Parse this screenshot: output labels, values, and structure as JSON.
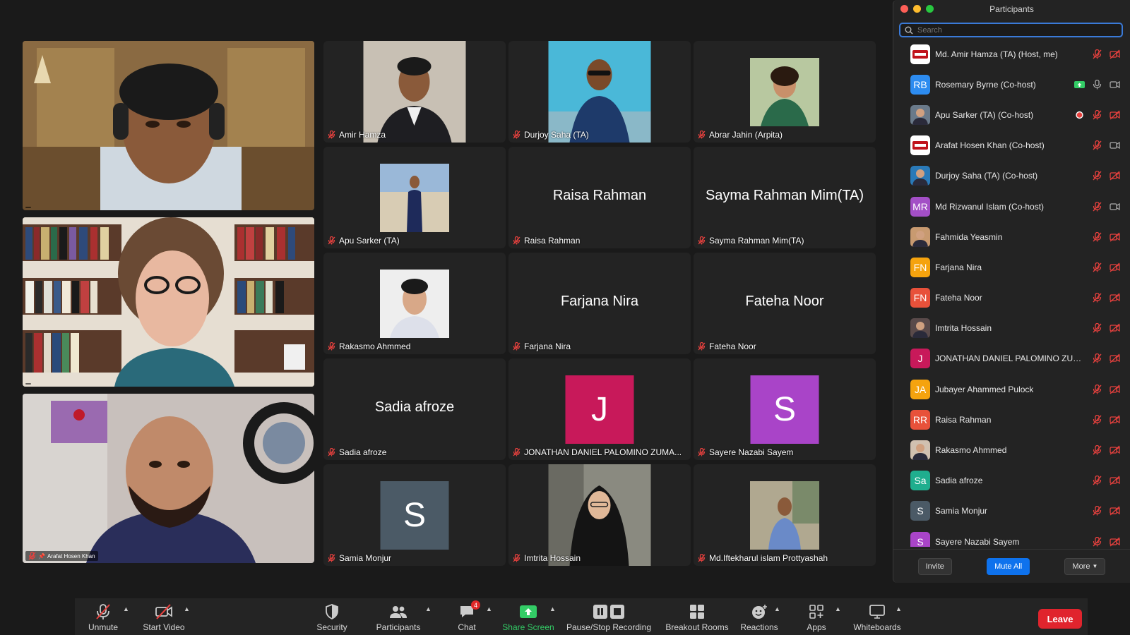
{
  "colors": {
    "accent": "#0e72ed",
    "mute_red": "#e8413e",
    "share_green": "#33cc66",
    "leave_red": "#e0242d"
  },
  "speakers": [
    {
      "name": ""
    },
    {
      "name": ""
    },
    {
      "name": "Arafat Hosen Khan"
    }
  ],
  "gallery": [
    {
      "label": "Amir Hamza",
      "kind": "photo"
    },
    {
      "label": "Durjoy Saha (TA)",
      "kind": "photo"
    },
    {
      "label": "Abrar Jahin (Arpita)",
      "kind": "photo-small"
    },
    {
      "label": "Apu Sarker (TA)",
      "kind": "photo-small"
    },
    {
      "label": "Raisa Rahman",
      "kind": "name",
      "big": "Raisa Rahman"
    },
    {
      "label": "Sayma Rahman Mim(TA)",
      "kind": "name",
      "big": "Sayma Rahman Mim(TA)"
    },
    {
      "label": "Rakasmo Ahmmed",
      "kind": "photo-small"
    },
    {
      "label": "Farjana Nira",
      "kind": "name",
      "big": "Farjana Nira"
    },
    {
      "label": "Fateha Noor",
      "kind": "name",
      "big": "Fateha Noor"
    },
    {
      "label": "Sadia afroze",
      "kind": "name",
      "big": "Sadia afroze"
    },
    {
      "label": "JONATHAN DANIEL PALOMINO ZUMA...",
      "kind": "avatar",
      "letter": "J",
      "color": "#c8195a"
    },
    {
      "label": "Sayere Nazabi Sayem",
      "kind": "avatar",
      "letter": "S",
      "color": "#a944c8"
    },
    {
      "label": "Samia Monjur",
      "kind": "avatar",
      "letter": "S",
      "color": "#4b5a66"
    },
    {
      "label": "Imtrita Hossain",
      "kind": "photo"
    },
    {
      "label": "Md.Iftekharul islam Prottyashah",
      "kind": "photo-small"
    }
  ],
  "participants_panel": {
    "title": "Participants",
    "search_placeholder": "Search",
    "items": [
      {
        "name": "Md. Amir Hamza (TA) (Host, me)",
        "avatar": "logo",
        "color": "#ffffff",
        "mic": "muted",
        "video": "off"
      },
      {
        "name": "Rosemary Byrne (Co-host)",
        "avatar": "RB",
        "color": "#2d8cf0",
        "mic": "on",
        "video": "on",
        "sharing": true
      },
      {
        "name": "Apu Sarker (TA) (Co-host)",
        "avatar": "photo",
        "color": "#6a7a8a",
        "mic": "muted",
        "video": "off",
        "recording": true
      },
      {
        "name": "Arafat Hosen Khan (Co-host)",
        "avatar": "logo",
        "color": "#ffffff",
        "mic": "muted",
        "video": "on"
      },
      {
        "name": "Durjoy Saha (TA) (Co-host)",
        "avatar": "photo",
        "color": "#2a7ab8",
        "mic": "muted",
        "video": "off"
      },
      {
        "name": "Md Rizwanul Islam (Co-host)",
        "avatar": "MR",
        "color": "#a34fc6",
        "mic": "muted",
        "video": "on"
      },
      {
        "name": "Fahmida Yeasmin",
        "avatar": "photo",
        "color": "#c89a70",
        "mic": "muted",
        "video": "off"
      },
      {
        "name": "Farjana Nira",
        "avatar": "FN",
        "color": "#f5a30e",
        "mic": "muted",
        "video": "off"
      },
      {
        "name": "Fateha Noor",
        "avatar": "FN",
        "color": "#e8513a",
        "mic": "muted",
        "video": "off"
      },
      {
        "name": "Imtrita Hossain",
        "avatar": "photo",
        "color": "#5a4a4a",
        "mic": "muted",
        "video": "off"
      },
      {
        "name": "JONATHAN DANIEL PALOMINO ZUM...",
        "avatar": "J",
        "color": "#c8195a",
        "mic": "muted",
        "video": "off"
      },
      {
        "name": "Jubayer Ahammed Pulock",
        "avatar": "JA",
        "color": "#f5a30e",
        "mic": "muted",
        "video": "off"
      },
      {
        "name": "Raisa Rahman",
        "avatar": "RR",
        "color": "#e8513a",
        "mic": "muted",
        "video": "off"
      },
      {
        "name": "Rakasmo Ahmmed",
        "avatar": "photo",
        "color": "#d0c0b0",
        "mic": "muted",
        "video": "off"
      },
      {
        "name": "Sadia afroze",
        "avatar": "Sa",
        "color": "#1fae8e",
        "mic": "muted",
        "video": "off"
      },
      {
        "name": "Samia Monjur",
        "avatar": "S",
        "color": "#4b5a66",
        "mic": "muted",
        "video": "off"
      },
      {
        "name": "Sayere Nazabi Sayem",
        "avatar": "S",
        "color": "#a944c8",
        "mic": "muted",
        "video": "off"
      }
    ],
    "invite_label": "Invite",
    "mute_all_label": "Mute All",
    "more_label": "More"
  },
  "toolbar": {
    "unmute": "Unmute",
    "start_video": "Start Video",
    "security": "Security",
    "participants": "Participants",
    "chat": "Chat",
    "chat_badge": "4",
    "share_screen": "Share Screen",
    "recording": "Pause/Stop Recording",
    "breakout": "Breakout Rooms",
    "reactions": "Reactions",
    "apps": "Apps",
    "whiteboards": "Whiteboards",
    "leave": "Leave"
  }
}
